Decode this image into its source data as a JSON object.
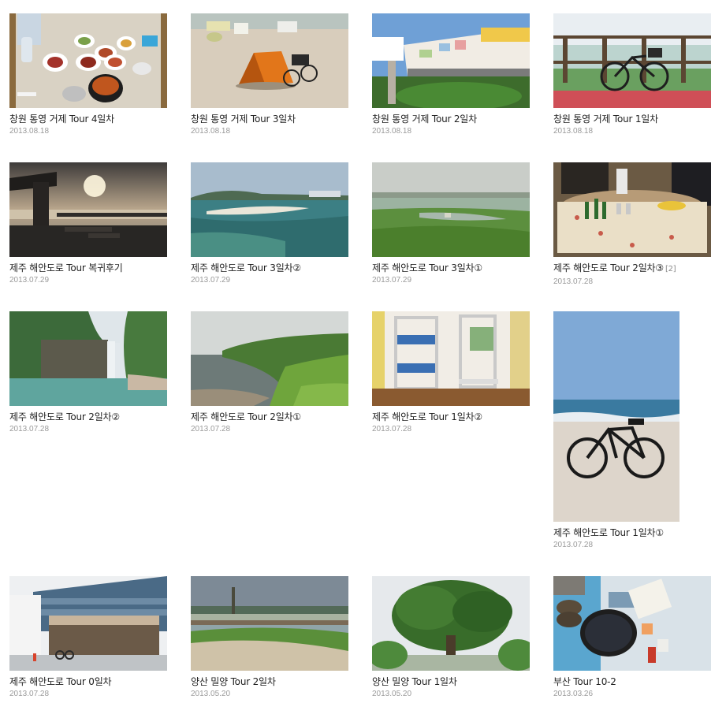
{
  "posts": [
    {
      "title": "창원 통영 거제 Tour 4일차",
      "date": "2013.08.18",
      "photo": "korean-meal"
    },
    {
      "title": "창원 통영 거제 Tour 3일차",
      "date": "2013.08.18",
      "photo": "tent-on-beach"
    },
    {
      "title": "창원 통영 거제 Tour 2일차",
      "date": "2013.08.18",
      "photo": "painted-wall-village"
    },
    {
      "title": "창원 통영 거제 Tour 1일차",
      "date": "2013.08.18",
      "photo": "bicycle-at-railing"
    },
    {
      "title": "제주 해안도로 Tour 복귀후기",
      "date": "2013.07.29",
      "photo": "sunset-pier"
    },
    {
      "title": "제주 해안도로 Tour 3일차②",
      "date": "2013.07.29",
      "photo": "turquoise-sea"
    },
    {
      "title": "제주 해안도로 Tour 3일차①",
      "date": "2013.07.29",
      "photo": "misty-meadow"
    },
    {
      "title": "제주 해안도로 Tour 2일차③",
      "date": "2013.07.28",
      "photo": "table-with-drinks",
      "count": "[2]"
    },
    {
      "title": "제주 해안도로 Tour 2일차②",
      "date": "2013.07.28",
      "photo": "waterfall"
    },
    {
      "title": "제주 해안도로 Tour 2일차①",
      "date": "2013.07.28",
      "photo": "coastal-cliff"
    },
    {
      "title": "제주 해안도로 Tour 1일차②",
      "date": "2013.07.28",
      "photo": "bunk-bed-room"
    },
    {
      "title": "제주 해안도로 Tour 1일차①",
      "date": "2013.07.28",
      "photo": "bicycle-on-beach"
    },
    {
      "title": "제주 해안도로 Tour 0일차",
      "date": "2013.07.28",
      "photo": "ferry-terminal"
    },
    {
      "title": "양산 밀양 Tour 2일차",
      "date": "2013.05.20",
      "photo": "riverside-wetland"
    },
    {
      "title": "양산 밀양 Tour 1일차",
      "date": "2013.05.20",
      "photo": "big-tree"
    },
    {
      "title": "부산 Tour 10-2",
      "date": "2013.03.26",
      "photo": "mussels-picnic"
    }
  ]
}
